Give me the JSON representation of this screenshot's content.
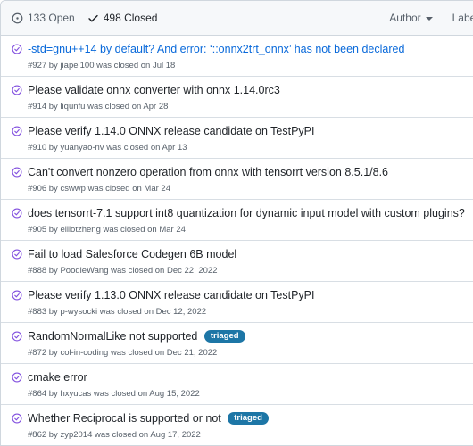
{
  "header": {
    "open_label": "133 Open",
    "closed_label": "498 Closed",
    "author_label": "Author",
    "label_label": "Label"
  },
  "colors": {
    "closed_icon": "#8250df",
    "label_bg": "#1d76a6",
    "link": "#0969da"
  },
  "issues": [
    {
      "title": "-std=gnu++14 by default? And error: ‘::onnx2trt_onnx’ has not been declared",
      "meta": "#927 by jiapei100 was closed on Jul 18",
      "label": ""
    },
    {
      "title": "Please validate onnx converter with onnx 1.14.0rc3",
      "meta": "#914 by liqunfu was closed on Apr 28",
      "label": ""
    },
    {
      "title": "Please verify 1.14.0 ONNX release candidate on TestPyPI",
      "meta": "#910 by yuanyao-nv was closed on Apr 13",
      "label": ""
    },
    {
      "title": "Can't convert nonzero operation from onnx with tensorrt version 8.5.1/8.6",
      "meta": "#906 by cswwp was closed on Mar 24",
      "label": ""
    },
    {
      "title": "does tensorrt-7.1 support int8 quantization for dynamic input model with custom plugins?",
      "meta": "#905 by elliotzheng was closed on Mar 24",
      "label": ""
    },
    {
      "title": "Fail to load Salesforce Codegen 6B model",
      "meta": "#888 by PoodleWang was closed on Dec 22, 2022",
      "label": ""
    },
    {
      "title": "Please verify 1.13.0 ONNX release candidate on TestPyPI",
      "meta": "#883 by p-wysocki was closed on Dec 12, 2022",
      "label": ""
    },
    {
      "title": "RandomNormalLike not supported",
      "meta": "#872 by col-in-coding was closed on Dec 21, 2022",
      "label": "triaged"
    },
    {
      "title": "cmake error",
      "meta": "#864 by hxyucas was closed on Aug 15, 2022",
      "label": ""
    },
    {
      "title": "Whether Reciprocal is supported or not",
      "meta": "#862 by zyp2014 was closed on Aug 17, 2022",
      "label": "triaged"
    }
  ]
}
